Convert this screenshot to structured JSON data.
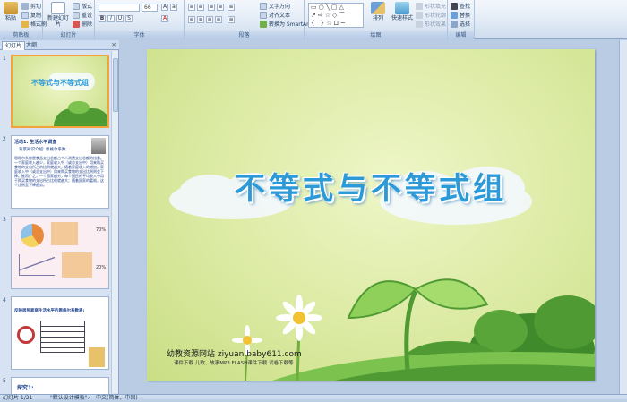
{
  "ribbon": {
    "clipboard": {
      "paste": "粘贴",
      "cut": "剪切",
      "copy": "复制",
      "format_painter": "格式刷",
      "label": "剪贴板"
    },
    "slides": {
      "new_slide": "新建幻灯片",
      "layout": "版式",
      "reset": "重设",
      "delete": "删除",
      "label": "幻灯片"
    },
    "font": {
      "size": "66",
      "label": "字体"
    },
    "paragraph": {
      "text_direction": "文字方向",
      "align_text": "对齐文本",
      "smartart": "转换为 SmartArt",
      "label": "段落"
    },
    "drawing": {
      "arrange": "排列",
      "quick_styles": "快速样式",
      "shape_fill": "形状填充",
      "shape_outline": "形状轮廓",
      "shape_effects": "形状效果",
      "label": "绘图"
    },
    "editing": {
      "find": "查找",
      "replace": "替换",
      "select": "选择",
      "label": "编辑"
    }
  },
  "leftpane": {
    "tabs": [
      "幻灯片",
      "大纲"
    ],
    "close": "×",
    "slide_numbers": [
      "1",
      "2",
      "3",
      "4",
      "5"
    ],
    "thumb1_title": "不等式与不等式组",
    "thumb2_heading": "活动1: 生活水平调查",
    "thumb2_sub": "背景知识介绍: 恩格尔系数",
    "thumb2_body": "恩格尔系数是食品支出总额占个人消费支出总额的比重。一个家庭收入越少，家庭收入中（或总支出中）用来购买食物的支出所占的比例就越大，随着家庭收入的增加，家庭收入中（或总支出中）用来购买食物的支出比例则会下降。推而广之，一个国家越穷，每个国民的平均收入中用于购买食物的支出所占比例就越大；随着国家的富裕，这个比例呈下降趋势。",
    "thumb3_pct1": "70%",
    "thumb3_pct2": "20%",
    "thumb4_heading": "反映居民家庭生活水平的恩格尔系数表:",
    "thumb5_heading": "探究1:"
  },
  "slide": {
    "title": "不等式与不等式组",
    "footer_line1": "幼教资源网站  ziyuan.baby611.com",
    "footer_line2": "课件下载    儿歌、故事MP3    FLASH课件下载    试卷下载等"
  },
  "statusbar": {
    "slide_info": "幻灯片 1/21",
    "theme": "\"默认设计模板\"",
    "language": "中文(简体，中国)"
  },
  "colors": {
    "title_blue": "#2d9ad8",
    "slide_bg": "#dbeaa2",
    "selection_orange": "#f3a33a",
    "ribbon_blue": "#b9cce4"
  }
}
